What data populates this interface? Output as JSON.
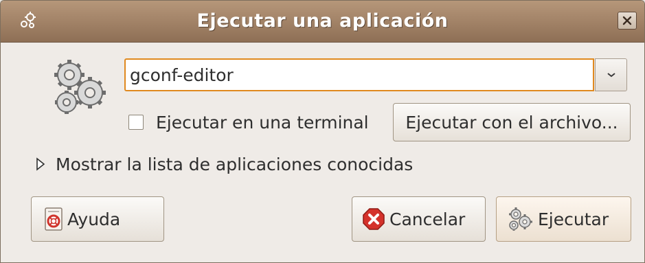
{
  "window": {
    "title": "Ejecutar una aplicación",
    "app_icon": "gears-app-icon",
    "close_icon": "close-icon"
  },
  "dialog": {
    "icon": "gears-icon",
    "command_value": "gconf-editor",
    "combo_arrow_icon": "chevron-down-icon",
    "run_in_terminal": {
      "label": "Ejecutar en una terminal",
      "mnemonic": "t",
      "checked": false
    },
    "run_with_file_label": "Ejecutar con el archivo...",
    "expander": {
      "label": "Mostrar la lista de aplicaciones conocidas",
      "icon": "triangle-right-icon",
      "expanded": false
    }
  },
  "buttons": {
    "help": {
      "label": "Ayuda",
      "icon": "help-icon"
    },
    "cancel": {
      "label": "Cancelar",
      "icon": "cancel-icon"
    },
    "run": {
      "label": "Ejecutar",
      "icon": "gears-icon"
    }
  },
  "colors": {
    "titlebar": "#9e7f64",
    "focus_border": "#e0891f",
    "window_bg": "#efebe7"
  }
}
